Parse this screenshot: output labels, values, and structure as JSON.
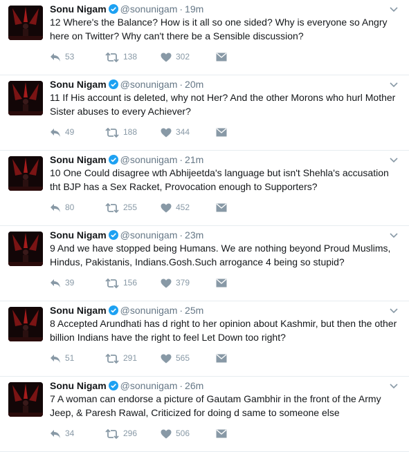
{
  "tweets": [
    {
      "name": "Sonu Nigam",
      "handle": "@sonunigam",
      "time": "19m",
      "text": "12 Where's the Balance? How is it all so one sided? Why is everyone so Angry here on Twitter? Why can't there be a Sensible discussion?",
      "replies": "53",
      "retweets": "138",
      "likes": "302"
    },
    {
      "name": "Sonu Nigam",
      "handle": "@sonunigam",
      "time": "20m",
      "text": "11 If His account is deleted, why not Her? And the other Morons who hurl Mother Sister abuses to every Achiever?",
      "replies": "49",
      "retweets": "188",
      "likes": "344"
    },
    {
      "name": "Sonu Nigam",
      "handle": "@sonunigam",
      "time": "21m",
      "text": "10 One Could disagree wth Abhijeetda's language but isn't Shehla's accusation tht BJP has a Sex Racket, Provocation enough to Supporters?",
      "replies": "80",
      "retweets": "255",
      "likes": "452"
    },
    {
      "name": "Sonu Nigam",
      "handle": "@sonunigam",
      "time": "23m",
      "text": "9 And we have stopped being Humans. We are nothing beyond Proud Muslims, Hindus, Pakistanis, Indians.Gosh.Such arrogance 4 being so stupid?",
      "replies": "39",
      "retweets": "156",
      "likes": "379"
    },
    {
      "name": "Sonu Nigam",
      "handle": "@sonunigam",
      "time": "25m",
      "text": "8 Accepted Arundhati has d right to her opinion about Kashmir, but then the other billion Indians have the right to feel Let Down too right?",
      "replies": "51",
      "retweets": "291",
      "likes": "565"
    },
    {
      "name": "Sonu Nigam",
      "handle": "@sonunigam",
      "time": "26m",
      "text": "7 A woman can endorse a picture of Gautam Gambhir in the front of the Army Jeep, & Paresh Rawal, Criticized for doing d same to someone else",
      "replies": "34",
      "retweets": "296",
      "likes": "506"
    }
  ],
  "separator": "·",
  "colors": {
    "verified": "#1da1f2",
    "action": "#8899a6",
    "handle": "#657786"
  },
  "icons": [
    "avatar",
    "verified-badge-icon",
    "chevron-down-icon",
    "reply-icon",
    "retweet-icon",
    "heart-icon",
    "direct-message-icon"
  ]
}
